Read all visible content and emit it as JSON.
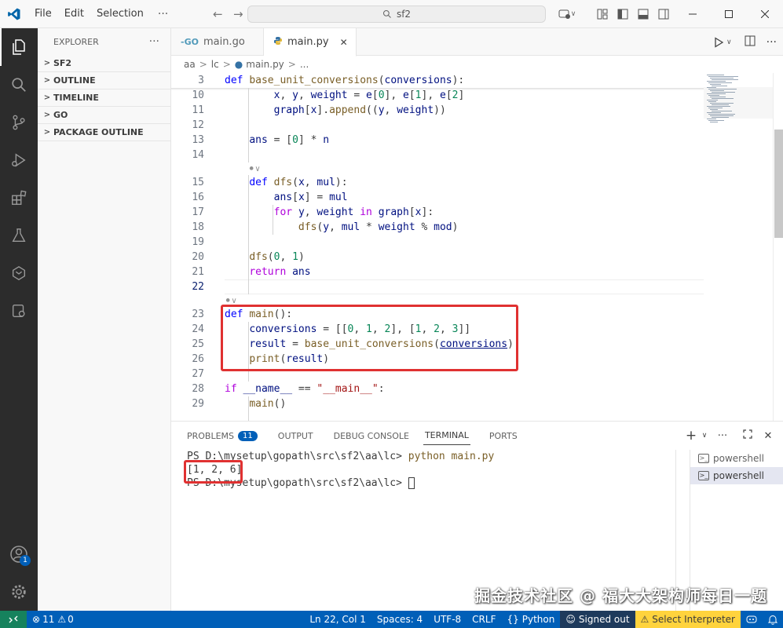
{
  "titlebar": {
    "menu": [
      "File",
      "Edit",
      "Selection"
    ],
    "more": "···",
    "search": "sf2"
  },
  "sidebar": {
    "title": "EXPLORER",
    "more": "···",
    "sections": [
      "SF2",
      "OUTLINE",
      "TIMELINE",
      "GO",
      "PACKAGE OUTLINE"
    ]
  },
  "activity": {
    "accounts_badge": "1"
  },
  "tabs": [
    {
      "label": "main.go",
      "icon": "go-file-icon"
    },
    {
      "label": "main.py",
      "icon": "python-file-icon",
      "close": "✕"
    }
  ],
  "breadcrumb": {
    "folder1": "aa",
    "folder2": "lc",
    "file": "main.py",
    "more": "..."
  },
  "editor": {
    "codelens": "⚫∨",
    "lines": [
      {
        "n": "3",
        "html": "<span class=\"kw\">def</span> <span class=\"fn\">base_unit_conversions</span>(<span class=\"var\">conversions</span>):"
      },
      {
        "n": "10",
        "html": "        <span class=\"var\">x</span>, <span class=\"var\">y</span>, <span class=\"var\">weight</span> = <span class=\"var\">e</span>[<span class=\"num\">0</span>], <span class=\"var\">e</span>[<span class=\"num\">1</span>], <span class=\"var\">e</span>[<span class=\"num\">2</span>]"
      },
      {
        "n": "11",
        "html": "        <span class=\"var\">graph</span>[<span class=\"var\">x</span>].<span class=\"fn\">append</span>((<span class=\"var\">y</span>, <span class=\"var\">weight</span>))"
      },
      {
        "n": "12",
        "html": ""
      },
      {
        "n": "13",
        "html": "    <span class=\"var\">ans</span> = [<span class=\"num\">0</span>] * <span class=\"var\">n</span>"
      },
      {
        "n": "14",
        "html": ""
      },
      {
        "n": "15",
        "html": "    <span class=\"kw\">def</span> <span class=\"fn\">dfs</span>(<span class=\"var\">x</span>, <span class=\"var\">mul</span>):"
      },
      {
        "n": "16",
        "html": "        <span class=\"var\">ans</span>[<span class=\"var\">x</span>] = <span class=\"var\">mul</span>"
      },
      {
        "n": "17",
        "html": "        <span class=\"ctl\">for</span> <span class=\"var\">y</span>, <span class=\"var\">weight</span> <span class=\"ctl\">in</span> <span class=\"var\">graph</span>[<span class=\"var\">x</span>]:"
      },
      {
        "n": "18",
        "html": "            <span class=\"fn\">dfs</span>(<span class=\"var\">y</span>, <span class=\"var\">mul</span> * <span class=\"var\">weight</span> % <span class=\"var\">mod</span>)"
      },
      {
        "n": "19",
        "html": ""
      },
      {
        "n": "20",
        "html": "    <span class=\"fn\">dfs</span>(<span class=\"num\">0</span>, <span class=\"num\">1</span>)"
      },
      {
        "n": "21",
        "html": "    <span class=\"ctl\">return</span> <span class=\"var\">ans</span>"
      },
      {
        "n": "22",
        "html": ""
      },
      {
        "n": "23",
        "html": "<span class=\"kw\">def</span> <span class=\"fn\">main</span>():"
      },
      {
        "n": "24",
        "html": "    <span class=\"var\">conversions</span> = [[<span class=\"num\">0</span>, <span class=\"num\">1</span>, <span class=\"num\">2</span>], [<span class=\"num\">1</span>, <span class=\"num\">2</span>, <span class=\"num\">3</span>]]"
      },
      {
        "n": "25",
        "html": "    <span class=\"var\">result</span> = <span class=\"fn\">base_unit_conversions</span>(<span class=\"var ul\">conversions</span>)"
      },
      {
        "n": "26",
        "html": "    <span class=\"fn\">print</span>(<span class=\"var\">result</span>)"
      },
      {
        "n": "27",
        "html": ""
      },
      {
        "n": "28",
        "html": "<span class=\"ctl\">if</span> <span class=\"var\">__name__</span> == <span class=\"str\">\"__main__\"</span>:"
      },
      {
        "n": "29",
        "html": "    <span class=\"fn\">main</span>()"
      }
    ]
  },
  "panel": {
    "tabs": [
      "PROBLEMS",
      "OUTPUT",
      "DEBUG CONSOLE",
      "TERMINAL",
      "PORTS"
    ],
    "problems_count": "11",
    "active_tab": "TERMINAL",
    "terminal": {
      "prompt1": "PS D:\\mysetup\\gopath\\src\\sf2\\aa\\lc> ",
      "command": "python main.py",
      "output": "[1, 2, 6]",
      "prompt2": "PS D:\\mysetup\\gopath\\src\\sf2\\aa\\lc> "
    },
    "terminals": [
      "powershell",
      "powershell"
    ]
  },
  "watermark": "掘金技术社区 @ 福大大架构师每日一题",
  "statusbar": {
    "errors": "11",
    "warnings": "0",
    "position": "Ln 22, Col 1",
    "spaces": "Spaces: 4",
    "encoding": "UTF-8",
    "eol": "CRLF",
    "language": "Python",
    "account": "Signed out",
    "interpreter": "Select Interpreter"
  },
  "colors": {
    "accent": "#005fb8",
    "highlight": "#e03131",
    "activitybar": "#2c2c2c",
    "remote": "#16825d"
  }
}
